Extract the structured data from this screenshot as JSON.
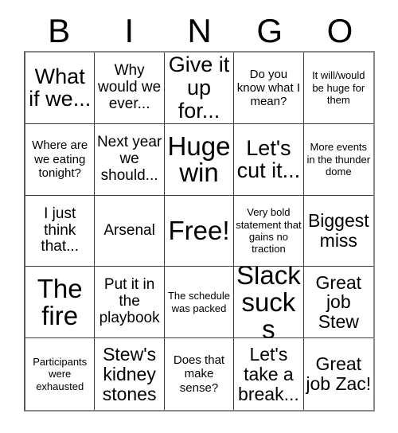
{
  "header": {
    "letters": [
      "B",
      "I",
      "N",
      "G",
      "O"
    ]
  },
  "colors": {
    "background": "#ffffff",
    "text": "#000000",
    "grid_border": "#8a8a8a",
    "cell_divider": "#3a3a3a"
  },
  "grid": {
    "columns": 5,
    "rows": 5,
    "cells": [
      {
        "text": "What if we...",
        "size": "fs-xl"
      },
      {
        "text": "Why would we ever...",
        "size": "fs-m"
      },
      {
        "text": "Give it up for...",
        "size": "fs-xl"
      },
      {
        "text": "Do you know what I mean?",
        "size": "fs-s"
      },
      {
        "text": "It will/would be huge for them",
        "size": "fs-xs"
      },
      {
        "text": "Where are we eating tonight?",
        "size": "fs-s"
      },
      {
        "text": "Next year we should...",
        "size": "fs-m"
      },
      {
        "text": "Huge win",
        "size": "fs-xxl"
      },
      {
        "text": "Let's cut it...",
        "size": "fs-xl"
      },
      {
        "text": "More events in the thunder dome",
        "size": "fs-xs"
      },
      {
        "text": "I just think that...",
        "size": "fs-m"
      },
      {
        "text": "Arsenal",
        "size": "fs-m"
      },
      {
        "text": "Free!",
        "size": "fs-xxl"
      },
      {
        "text": "Very bold statement that gains no traction",
        "size": "fs-xs"
      },
      {
        "text": "Biggest miss",
        "size": "fs-l"
      },
      {
        "text": "The fire",
        "size": "fs-xxl"
      },
      {
        "text": "Put it in the playbook",
        "size": "fs-m"
      },
      {
        "text": "The schedule was packed",
        "size": "fs-xs"
      },
      {
        "text": "Slack sucks",
        "size": "fs-xxl"
      },
      {
        "text": "Great job Stew",
        "size": "fs-l"
      },
      {
        "text": "Participants were exhausted",
        "size": "fs-xs"
      },
      {
        "text": "Stew's kidney stones",
        "size": "fs-l"
      },
      {
        "text": "Does that make sense?",
        "size": "fs-s"
      },
      {
        "text": "Let's take a break...",
        "size": "fs-l"
      },
      {
        "text": "Great job Zac!",
        "size": "fs-l"
      }
    ]
  }
}
